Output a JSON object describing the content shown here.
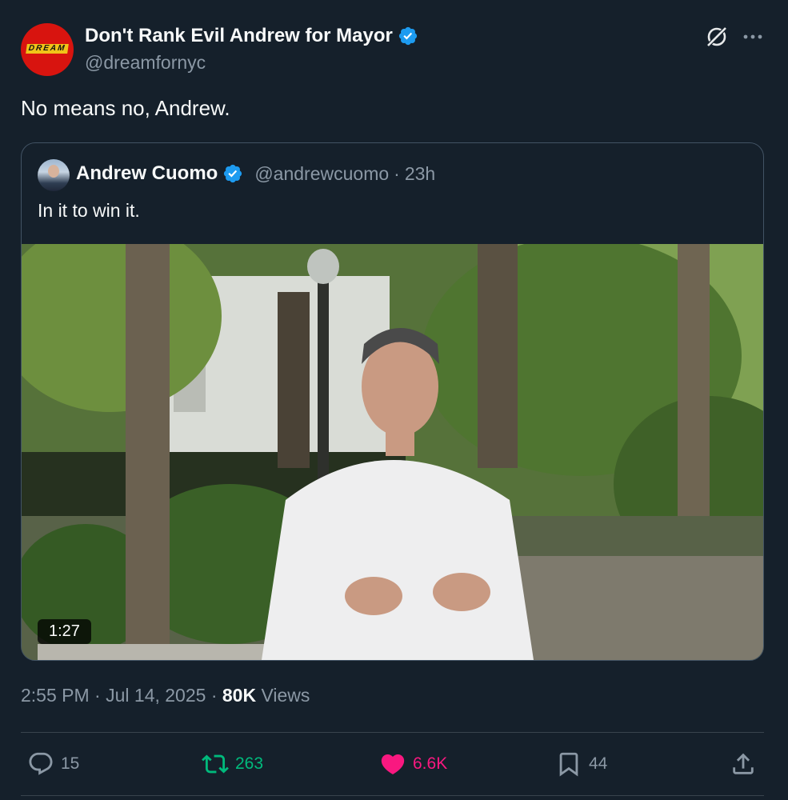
{
  "author": {
    "name": "Don't Rank Evil Andrew for Mayor",
    "handle": "@dreamfornyc",
    "avatar_text": "DREAM",
    "verified": true
  },
  "tweet": {
    "text": "No means no, Andrew."
  },
  "quoted": {
    "name": "Andrew Cuomo",
    "handle": "@andrewcuomo",
    "separator": "·",
    "time_ago": "23h",
    "text": "In it to win it.",
    "video_duration": "1:27"
  },
  "meta": {
    "time": "2:55 PM",
    "dot1": "·",
    "date": "Jul 14, 2025",
    "dot2": "·",
    "views_count": "80K",
    "views_label": "Views"
  },
  "actions": {
    "replies": "15",
    "retweets": "263",
    "likes": "6.6K",
    "bookmarks": "44"
  },
  "colors": {
    "background": "#15202b",
    "verified": "#1d9bf0",
    "retweet": "#00ba7c",
    "like": "#f91880",
    "muted": "#8b98a5"
  },
  "icons": [
    "verified-badge-icon",
    "grok-icon",
    "more-icon",
    "reply-icon",
    "retweet-icon",
    "like-icon",
    "bookmark-icon",
    "share-icon"
  ]
}
